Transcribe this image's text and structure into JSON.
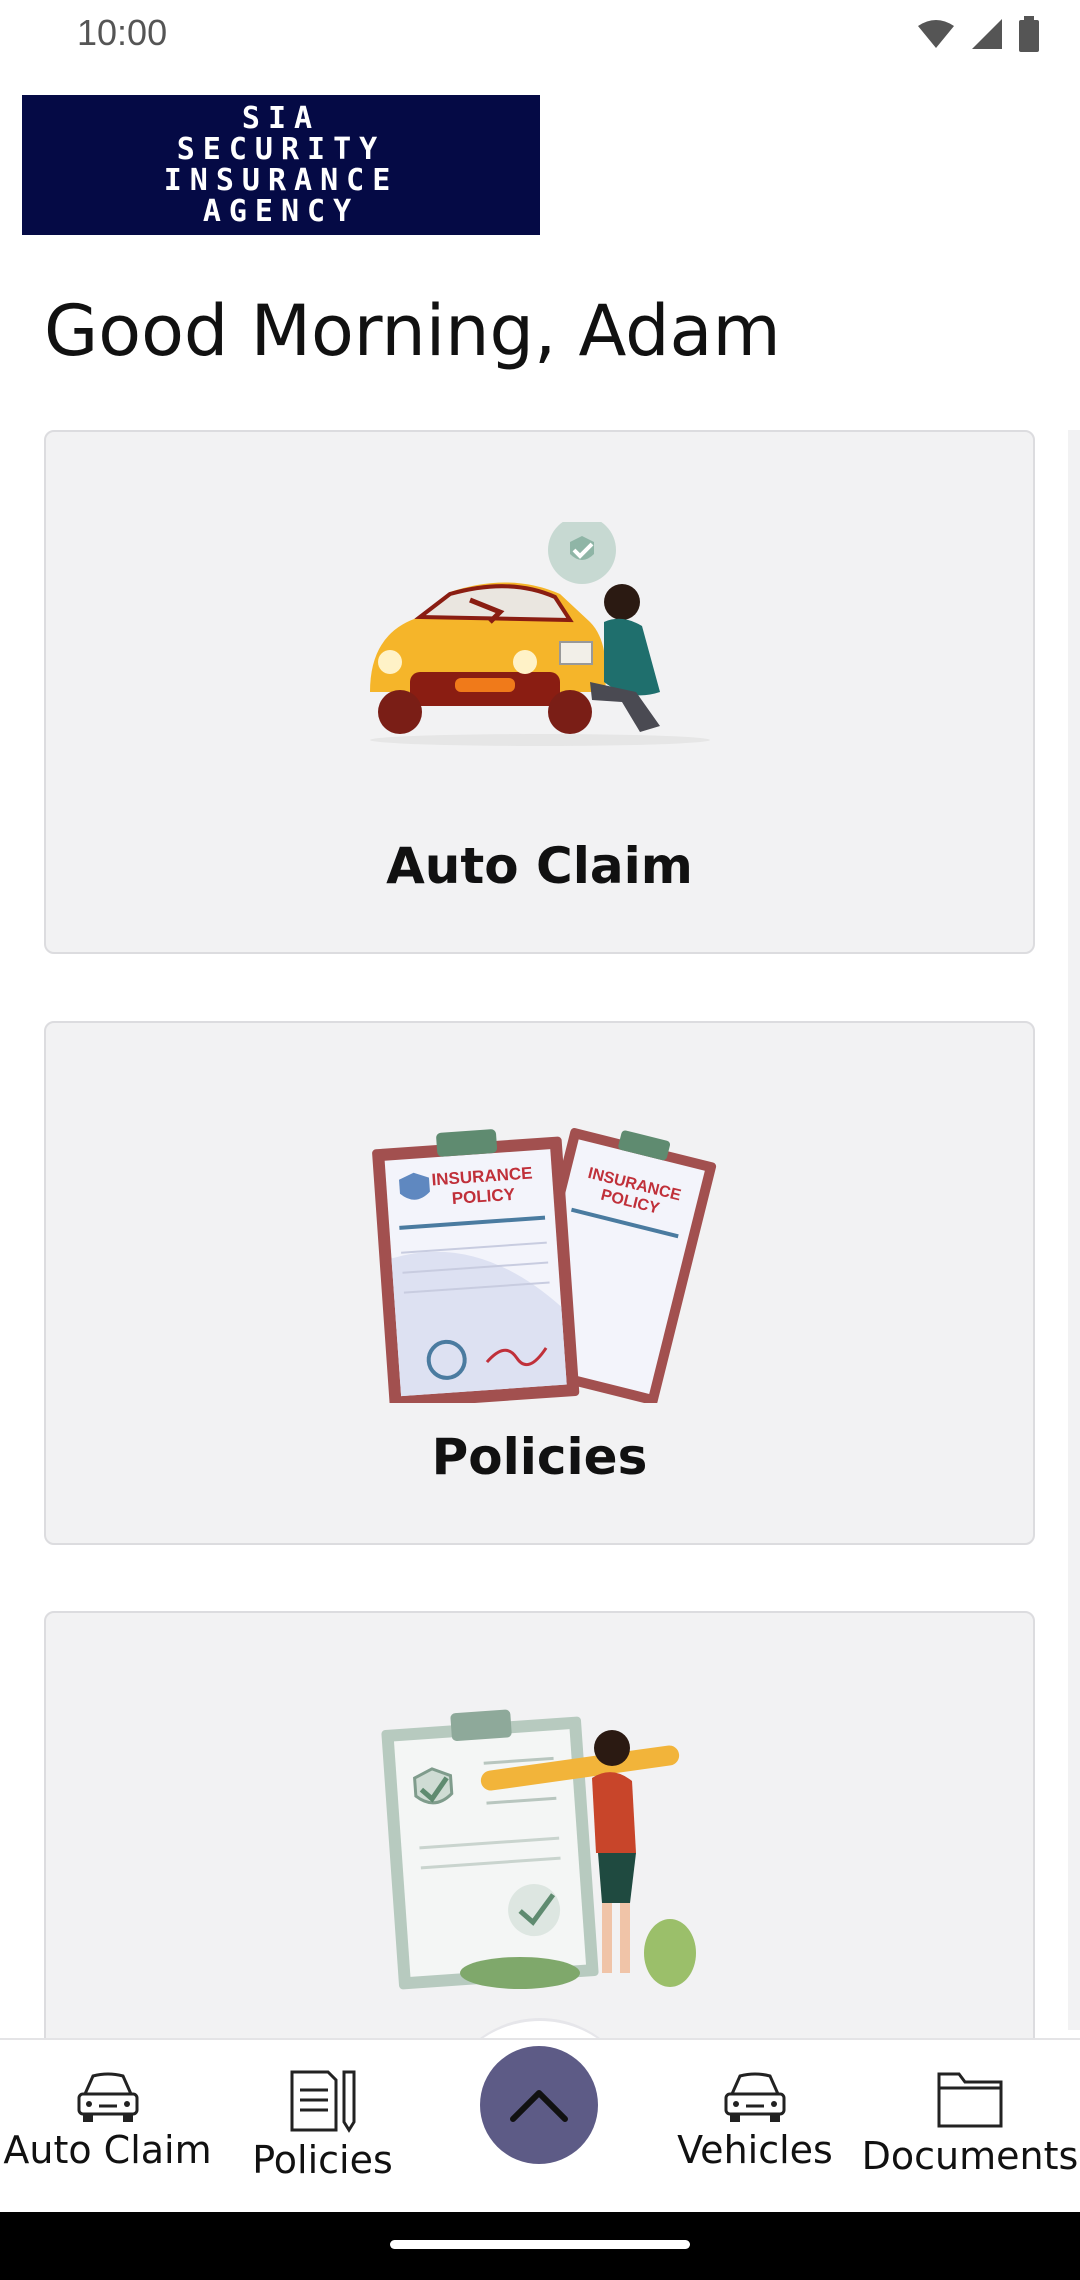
{
  "status_bar": {
    "time": "10:00",
    "icons": [
      "wifi-icon",
      "signal-icon",
      "battery-icon"
    ]
  },
  "logo": {
    "lines": [
      "SIA",
      "SECURITY",
      "INSURANCE",
      "AGENCY"
    ]
  },
  "greeting": "Good Morning, Adam",
  "cards": [
    {
      "label": "Auto Claim",
      "illustration": "car-damage-inspection-illustration"
    },
    {
      "label": "Policies",
      "illustration": "insurance-policy-clipboards-illustration",
      "illustration_text": [
        "INSURANCE",
        "POLICY",
        "INSURANCE",
        "POLICY"
      ]
    },
    {
      "label": "",
      "illustration": "checklist-woman-pencil-illustration"
    }
  ],
  "bottom_nav": {
    "items": [
      {
        "label": "Auto Claim",
        "icon": "car-icon"
      },
      {
        "label": "Policies",
        "icon": "document-pen-icon"
      },
      {
        "label": "Vehicles",
        "icon": "car-icon"
      },
      {
        "label": "Documents",
        "icon": "folder-icon"
      }
    ],
    "fab_icon": "chevron-up-icon"
  },
  "colors": {
    "logo_bg": "#050a45",
    "card_bg": "#f2f2f3",
    "fab": "#5d5b86"
  }
}
